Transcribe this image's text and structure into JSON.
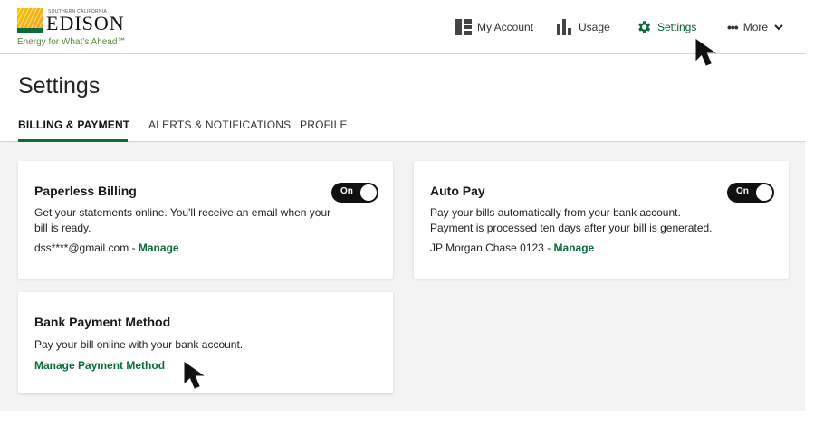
{
  "brand": {
    "small_text": "SOUTHERN CALIFORNIA",
    "name": "EDISON",
    "tagline": "Energy for What’s Ahead℠"
  },
  "nav": {
    "my_account": "My Account",
    "usage": "Usage",
    "settings": "Settings",
    "more": "More",
    "active": "Settings"
  },
  "page": {
    "title": "Settings",
    "tabs": [
      {
        "label": "BILLING & PAYMENT",
        "active": true
      },
      {
        "label": "ALERTS & NOTIFICATIONS",
        "active": false
      },
      {
        "label": "PROFILE",
        "active": false
      }
    ]
  },
  "cards": {
    "paperless": {
      "title": "Paperless Billing",
      "description": "Get your statements online. You'll receive an email when your bill is ready.",
      "detail": "dss****@gmail.com - ",
      "link": "Manage",
      "toggle_label": "On",
      "toggle_on": true
    },
    "autopay": {
      "title": "Auto Pay",
      "description_line1": "Pay your bills automatically from your bank account.",
      "description_line2": "Payment is processed ten days after your bill is generated.",
      "detail": "JP Morgan Chase 0123 - ",
      "link": "Manage",
      "toggle_label": "On",
      "toggle_on": true
    },
    "bank": {
      "title": "Bank Payment Method",
      "description": "Pay your bill online with your bank account.",
      "link": "Manage Payment Method"
    }
  },
  "colors": {
    "brand_green": "#0b6b3a",
    "brand_yellow": "#f7c20a",
    "toggle_bg": "#111111",
    "page_bg": "#f3f3f3"
  }
}
